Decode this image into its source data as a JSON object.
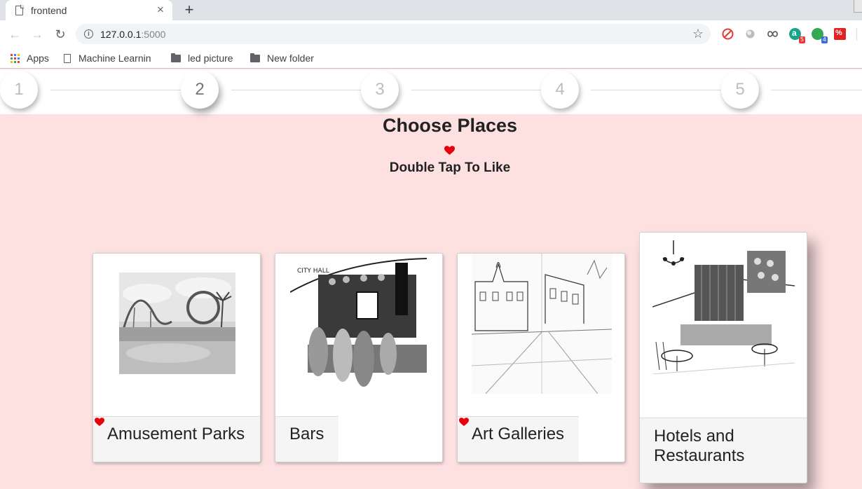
{
  "browser": {
    "tab_title": "frontend",
    "tab_close": "×",
    "new_tab": "+",
    "url_host": "127.0.0.1",
    "url_port": ":5000",
    "extensions": [
      {
        "name": "adblock-icon",
        "color": "#e53935"
      },
      {
        "name": "circle-ext-icon",
        "color": "#9e9e9e"
      },
      {
        "name": "infinity-ext-icon",
        "color": "#5f6368"
      },
      {
        "name": "a-ext-icon",
        "color": "#17a589",
        "badge": "5",
        "badge_color": "#e53935"
      },
      {
        "name": "green-ext-icon",
        "color": "#34a853",
        "badge": "4",
        "badge_color": "#3b6fd8"
      },
      {
        "name": "red-ext-icon",
        "color": "#e52020"
      }
    ],
    "bookmarks": {
      "apps": "Apps",
      "items": [
        "Machine Learnin",
        "led picture",
        "New folder"
      ]
    }
  },
  "stepper": {
    "steps": [
      "1",
      "2",
      "3",
      "4",
      "5"
    ],
    "active_index": 1
  },
  "main": {
    "title": "Choose Places",
    "subtitle": "Double Tap To Like",
    "accent": "#e8000b",
    "cards": [
      {
        "label": "Amusement Parks",
        "liked": true
      },
      {
        "label": "Bars",
        "liked": false
      },
      {
        "label": "Art Galleries",
        "liked": true
      },
      {
        "label": "Hotels and Restaurants",
        "liked": false,
        "highlighted": true
      }
    ]
  }
}
